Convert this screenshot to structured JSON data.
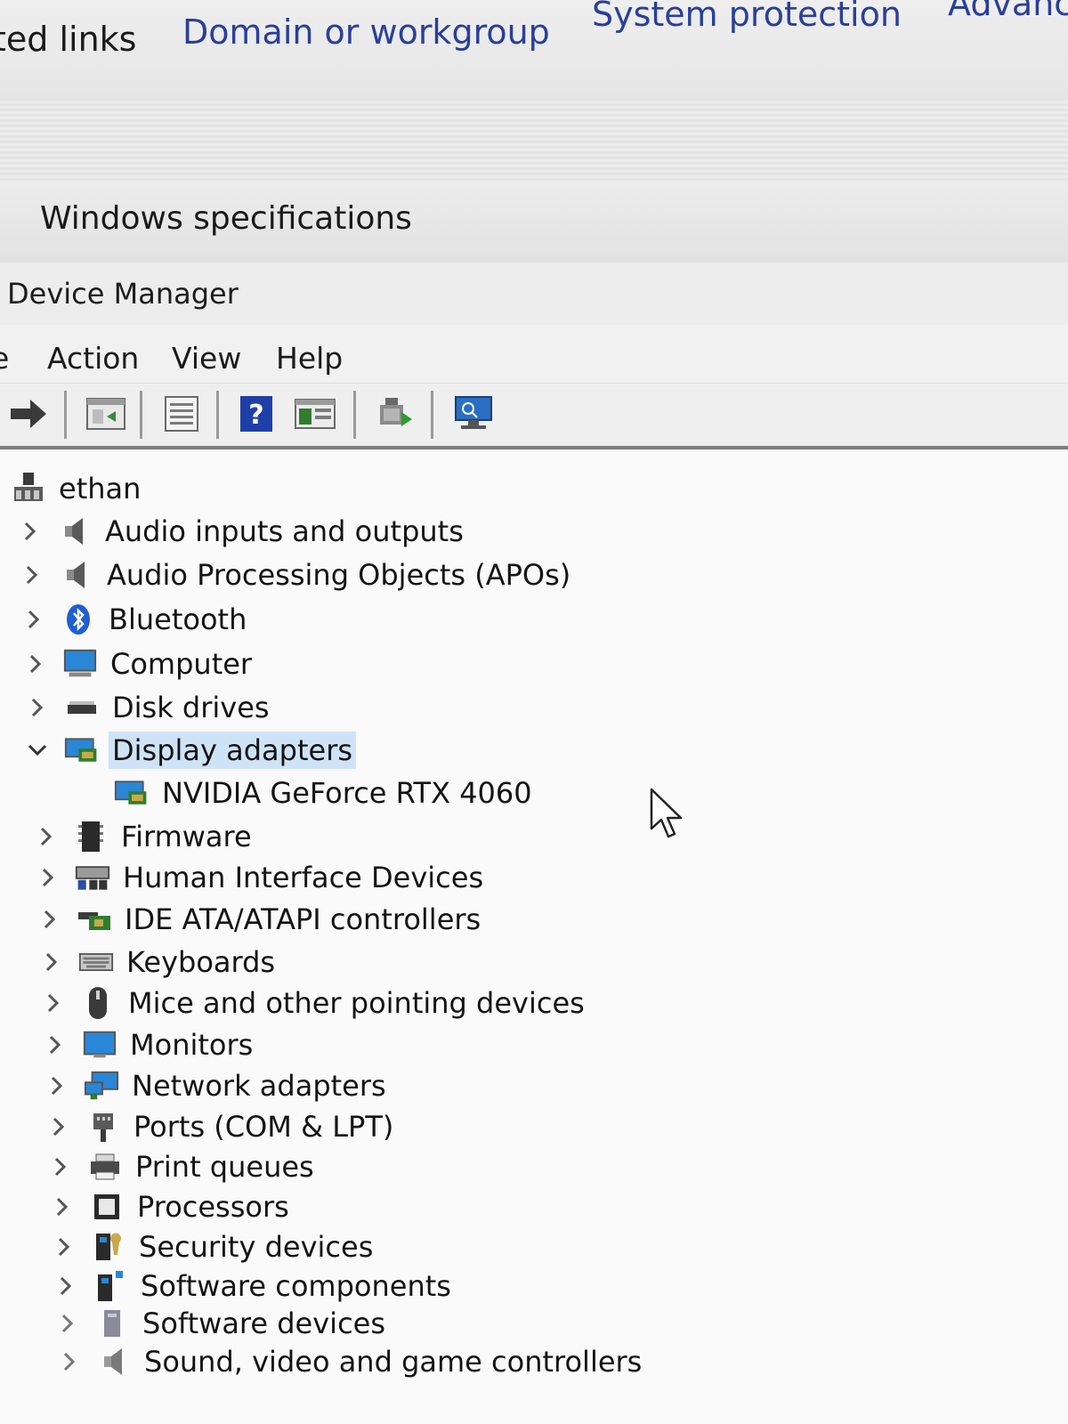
{
  "top_links": [
    "ted links",
    "Domain or workgroup",
    "System protection",
    "Advanc"
  ],
  "section_heading": "Windows specifications",
  "window": {
    "title": "Device Manager",
    "menu": [
      "e",
      "Action",
      "View",
      "Help"
    ],
    "toolbar_icons": [
      "forward-arrow-icon",
      "show-hide-console-tree-icon",
      "properties-icon",
      "help-icon",
      "run-icon",
      "update-driver-icon",
      "scan-hardware-icon"
    ]
  },
  "tree": {
    "root": "ethan",
    "categories": [
      {
        "label": "Audio inputs and outputs",
        "icon": "speaker-icon",
        "expanded": false
      },
      {
        "label": "Audio Processing Objects (APOs)",
        "icon": "speaker-icon",
        "expanded": false
      },
      {
        "label": "Bluetooth",
        "icon": "bluetooth-icon",
        "expanded": false
      },
      {
        "label": "Computer",
        "icon": "computer-icon",
        "expanded": false
      },
      {
        "label": "Disk drives",
        "icon": "disk-drive-icon",
        "expanded": false
      },
      {
        "label": "Display adapters",
        "icon": "display-adapter-icon",
        "expanded": true,
        "selected": true,
        "children": [
          "NVIDIA GeForce RTX 4060"
        ]
      },
      {
        "label": "Firmware",
        "icon": "firmware-icon",
        "expanded": false
      },
      {
        "label": "Human Interface Devices",
        "icon": "hid-icon",
        "expanded": false
      },
      {
        "label": "IDE ATA/ATAPI controllers",
        "icon": "ide-controller-icon",
        "expanded": false
      },
      {
        "label": "Keyboards",
        "icon": "keyboard-icon",
        "expanded": false
      },
      {
        "label": "Mice and other pointing devices",
        "icon": "mouse-icon",
        "expanded": false
      },
      {
        "label": "Monitors",
        "icon": "monitor-icon",
        "expanded": false
      },
      {
        "label": "Network adapters",
        "icon": "network-adapter-icon",
        "expanded": false
      },
      {
        "label": "Ports (COM & LPT)",
        "icon": "port-icon",
        "expanded": false
      },
      {
        "label": "Print queues",
        "icon": "printer-icon",
        "expanded": false
      },
      {
        "label": "Processors",
        "icon": "processor-icon",
        "expanded": false
      },
      {
        "label": "Security devices",
        "icon": "security-device-icon",
        "expanded": false
      },
      {
        "label": "Software components",
        "icon": "software-component-icon",
        "expanded": false
      },
      {
        "label": "Software devices",
        "icon": "software-device-icon",
        "expanded": false
      },
      {
        "label": "Sound, video and game controllers",
        "icon": "sound-controller-icon",
        "expanded": false
      }
    ]
  },
  "colors": {
    "link": "#2a3f9a",
    "selection": "#cfe3f7"
  }
}
